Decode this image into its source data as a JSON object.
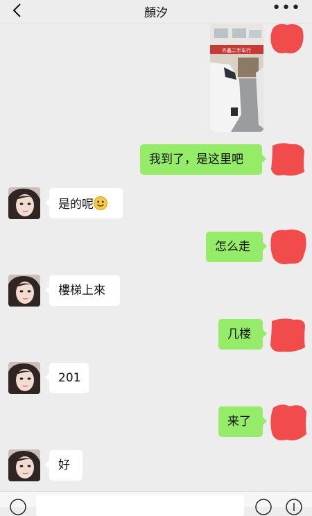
{
  "header": {
    "title": "顏汐",
    "back_icon": "chevron-left-icon",
    "more_icon": "more-dots-icon"
  },
  "messages": [
    {
      "side": "out",
      "type": "image"
    },
    {
      "side": "out",
      "type": "text",
      "text": "我到了，是这里吧"
    },
    {
      "side": "in",
      "type": "text",
      "text": "是的呢",
      "emoji": "smile-emoji-icon"
    },
    {
      "side": "out",
      "type": "text",
      "text": "怎么走"
    },
    {
      "side": "in",
      "type": "text",
      "text": "樓梯上來"
    },
    {
      "side": "out",
      "type": "text",
      "text": "几楼"
    },
    {
      "side": "in",
      "type": "text",
      "text": "201"
    },
    {
      "side": "out",
      "type": "text",
      "text": "来了"
    },
    {
      "side": "in",
      "type": "text",
      "text": "好"
    }
  ],
  "photo": {
    "sign_text": "齐鑫二手车行"
  },
  "input_bar": {
    "voice_icon": "voice-icon",
    "emoji_icon": "emoji-icon",
    "plus_icon": "plus-icon"
  },
  "colors": {
    "background": "#ededed",
    "bubble_out": "#95ec69",
    "bubble_in": "#ffffff",
    "redaction": "#f24b4b"
  }
}
